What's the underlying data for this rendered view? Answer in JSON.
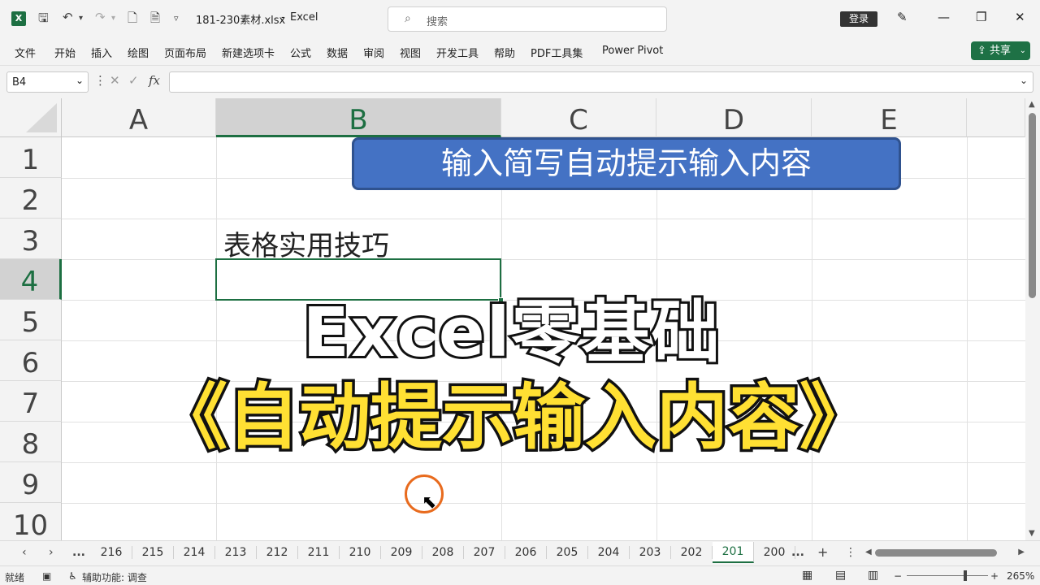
{
  "titlebar": {
    "filename": "181-230素材.xlsx",
    "separator": "-",
    "app": "Excel",
    "search_placeholder": "搜索",
    "login": "登录"
  },
  "menu": [
    "文件",
    "开始",
    "插入",
    "绘图",
    "页面布局",
    "新建选项卡",
    "公式",
    "数据",
    "审阅",
    "视图",
    "开发工具",
    "帮助",
    "PDF工具集",
    "Power Pivot"
  ],
  "share": "共享",
  "formula_bar": {
    "name_box": "B4",
    "fx": "fx",
    "value": ""
  },
  "columns": [
    "A",
    "B",
    "C",
    "D",
    "E"
  ],
  "rows": [
    "1",
    "2",
    "3",
    "4",
    "5",
    "6",
    "7",
    "8",
    "9",
    "10"
  ],
  "cells": {
    "B3": "表格实用技巧"
  },
  "banner": "输入简写自动提示输入内容",
  "overlay": {
    "line1": "Excel零基础",
    "line2": "《自动提示输入内容》"
  },
  "sheets": {
    "ellipsis": "...",
    "tabs": [
      "216",
      "215",
      "214",
      "213",
      "212",
      "211",
      "210",
      "209",
      "208",
      "207",
      "206",
      "205",
      "204",
      "203",
      "202",
      "201",
      "200"
    ],
    "active": "201",
    "more": "...",
    "add": "+"
  },
  "status": {
    "ready": "就绪",
    "accessibility": "辅助功能: 调查",
    "zoom": "265%"
  }
}
